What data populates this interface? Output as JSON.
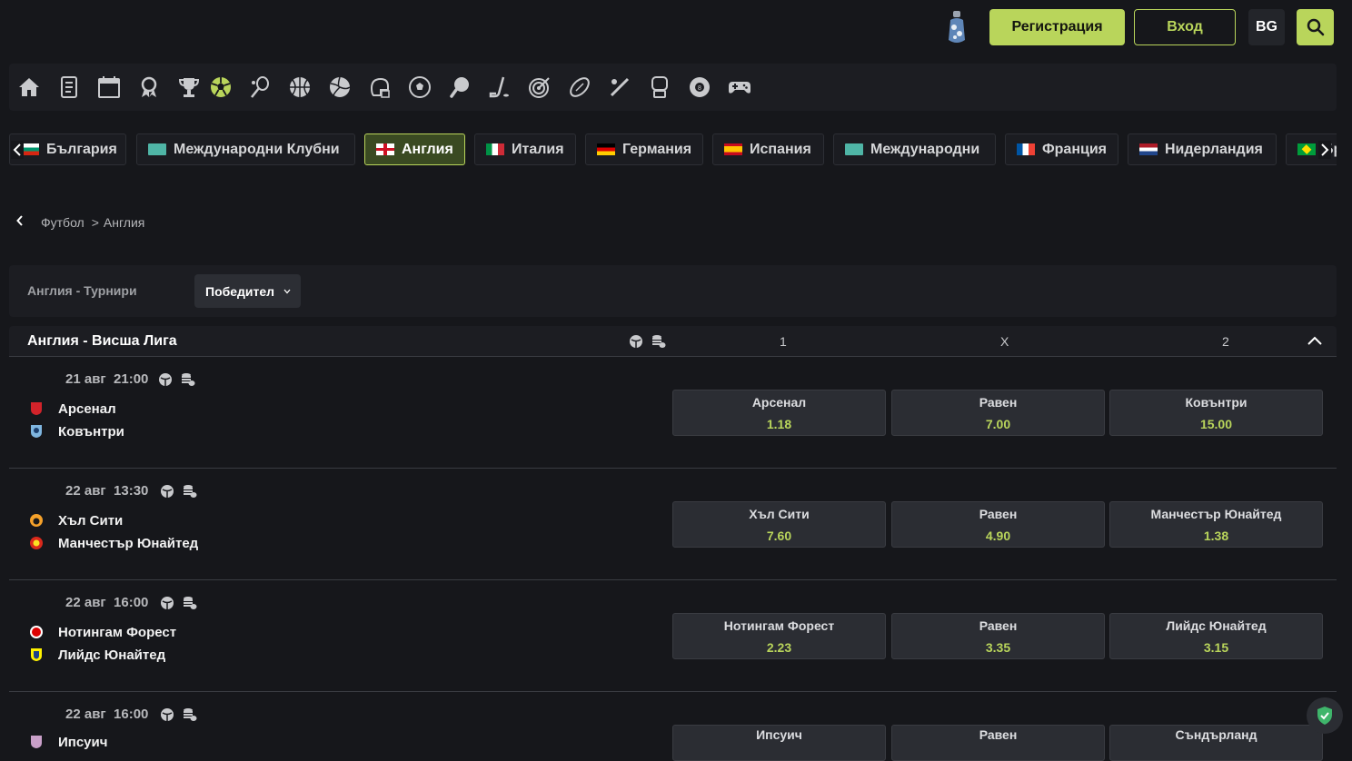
{
  "header": {
    "register_label": "Регистрация",
    "login_label": "Вход",
    "lang_label": "BG",
    "accent_color": "#b9d55b"
  },
  "sports": [
    "home-icon",
    "betslip-icon",
    "calendar-icon",
    "award-icon",
    "trophy-icon",
    "football-icon",
    "badminton-icon",
    "basketball-icon",
    "volleyball-icon",
    "american-football-icon",
    "handball-icon",
    "table-tennis-icon",
    "hockey-icon",
    "darts-icon",
    "rugby-icon",
    "snooker-cue-icon",
    "boxing-icon",
    "billiards-icon",
    "gamepad-icon"
  ],
  "countries": [
    {
      "label": "България",
      "flag": "bg"
    },
    {
      "label": "Международни Клубни",
      "flag": "world"
    },
    {
      "label": "Англия",
      "flag": "en",
      "active": true
    },
    {
      "label": "Италия",
      "flag": "it"
    },
    {
      "label": "Германия",
      "flag": "de"
    },
    {
      "label": "Испания",
      "flag": "es"
    },
    {
      "label": "Международни",
      "flag": "world"
    },
    {
      "label": "Франция",
      "flag": "fr"
    },
    {
      "label": "Нидерландия",
      "flag": "nl"
    },
    {
      "label": "Бр",
      "flag": "br"
    }
  ],
  "breadcrumb": {
    "sport": "Футбол",
    "sep": ">",
    "country": "Англия"
  },
  "filter": {
    "label": "Англия - Турнири",
    "select_value": "Победител"
  },
  "league": {
    "title": "Англия - Висша Лига",
    "col1": "1",
    "colx": "X",
    "col2": "2"
  },
  "matches": [
    {
      "date": "21 авг",
      "time": "21:00",
      "home": "Арсенал",
      "away": "Ковънтри",
      "odds": [
        {
          "label": "Арсенал",
          "value": "1.18"
        },
        {
          "label": "Равен",
          "value": "7.00"
        },
        {
          "label": "Ковънтри",
          "value": "15.00"
        }
      ]
    },
    {
      "date": "22 авг",
      "time": "13:30",
      "home": "Хъл Сити",
      "away": "Манчестър Юнайтед",
      "odds": [
        {
          "label": "Хъл Сити",
          "value": "7.60"
        },
        {
          "label": "Равен",
          "value": "4.90"
        },
        {
          "label": "Манчестър Юнайтед",
          "value": "1.38"
        }
      ]
    },
    {
      "date": "22 авг",
      "time": "16:00",
      "home": "Нотингам Форест",
      "away": "Лийдс Юнайтед",
      "odds": [
        {
          "label": "Нотингам Форест",
          "value": "2.23"
        },
        {
          "label": "Равен",
          "value": "3.35"
        },
        {
          "label": "Лийдс Юнайтед",
          "value": "3.15"
        }
      ]
    },
    {
      "date": "22 авг",
      "time": "16:00",
      "home": "Ипсуич",
      "away": "",
      "odds": [
        {
          "label": "Ипсуич",
          "value": ""
        },
        {
          "label": "Равен",
          "value": ""
        },
        {
          "label": "Съндърланд",
          "value": ""
        }
      ]
    }
  ]
}
